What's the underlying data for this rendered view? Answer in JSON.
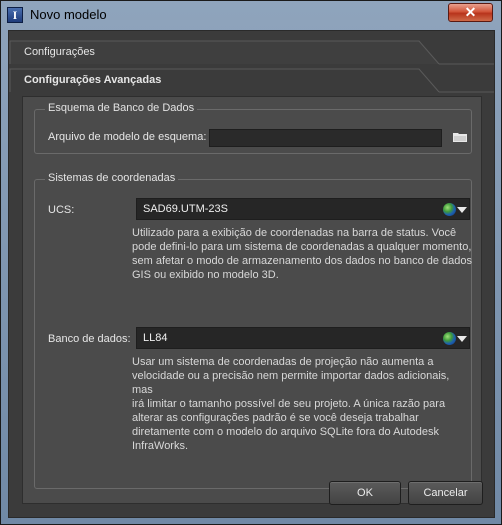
{
  "window": {
    "title": "Novo modelo",
    "close_label": "✕"
  },
  "tabs": [
    {
      "label": "Configurações"
    },
    {
      "label": "Configurações Avançadas"
    }
  ],
  "schema_group": {
    "title": "Esquema de Banco de Dados",
    "file_label": "Arquivo de modelo de esquema:",
    "file_value": ""
  },
  "coord_group": {
    "title": "Sistemas de coordenadas",
    "ucs": {
      "label": "UCS:",
      "value": "SAD69.UTM-23S",
      "description": "Utilizado para a exibição de coordenadas na barra de status. Você\npode defini-lo para um sistema de coordenadas a qualquer momento,\nsem afetar o modo de armazenamento dos dados no banco de dados\nGIS ou exibido no modelo 3D."
    },
    "db": {
      "label": "Banco de dados:",
      "value": "LL84",
      "description": "Usar um sistema de coordenadas de projeção não aumenta a\nvelocidade ou a precisão nem permite importar dados adicionais, mas\nirá limitar o tamanho possível de seu projeto. A única razão para\nalterar as configurações padrão é se você deseja trabalhar\ndiretamente com o modelo do arquivo SQLite fora do Autodesk\nInfraWorks."
    }
  },
  "buttons": {
    "ok": "OK",
    "cancel": "Cancelar"
  },
  "icons": {
    "app": "autodesk-infraworks-icon",
    "folder": "folder-icon",
    "globe": "globe-icon",
    "dropdown": "chevron-down-icon"
  },
  "colors": {
    "title_bar": "#7f97b4",
    "background": "#3b3b3b",
    "panel": "#4b4b4b",
    "close_button": "#c7442a"
  }
}
